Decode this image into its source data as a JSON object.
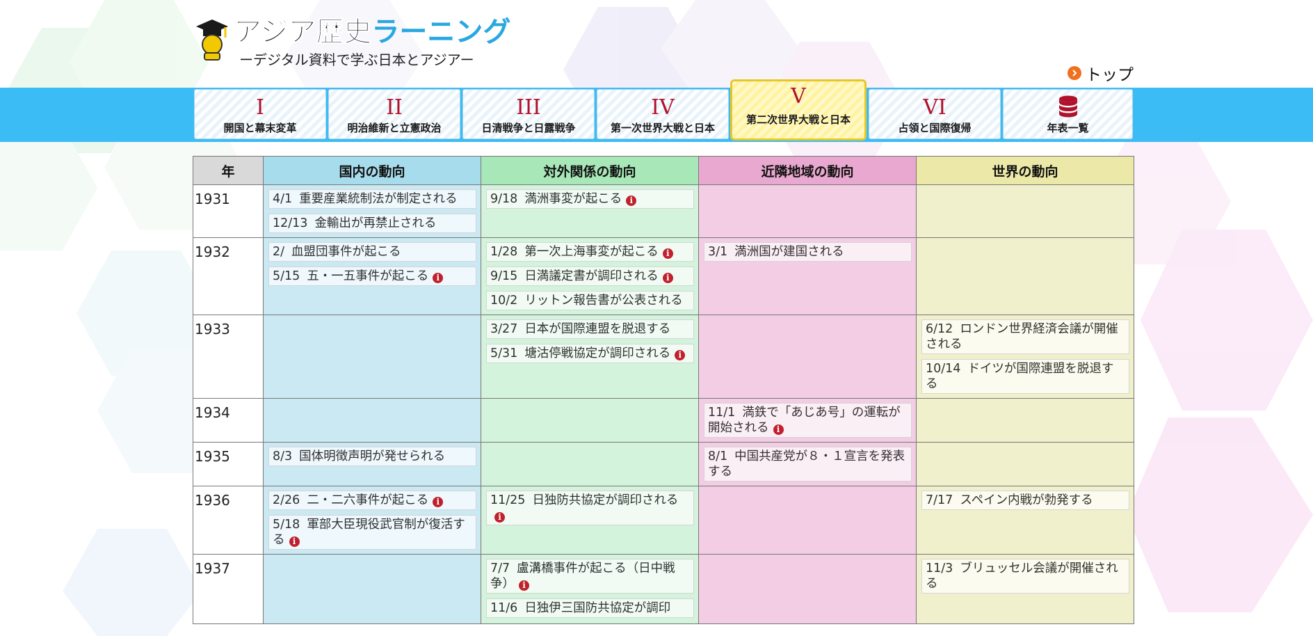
{
  "logo": {
    "title_a": "アジア歴史",
    "title_b": "ラーニング",
    "subtitle": "ーデジタル資料で学ぶ日本とアジアー"
  },
  "top_link": "トップ",
  "tabs": [
    {
      "num": "I",
      "label": "開国と幕末変革"
    },
    {
      "num": "II",
      "label": "明治維新と立憲政治"
    },
    {
      "num": "III",
      "label": "日清戦争と日露戦争"
    },
    {
      "num": "IV",
      "label": "第一次世界大戦と日本"
    },
    {
      "num": "V",
      "label": "第二次世界大戦と日本",
      "active": true
    },
    {
      "num": "VI",
      "label": "占領と国際復帰"
    },
    {
      "num": "",
      "label": "年表一覧"
    }
  ],
  "table": {
    "headers": {
      "year": "年",
      "domestic": "国内の動向",
      "foreign": "対外関係の動向",
      "neighbor": "近隣地域の動向",
      "world": "世界の動向"
    },
    "rows": [
      {
        "year": "1931",
        "domestic": [
          {
            "date": "4/1",
            "text": "重要産業統制法が制定される",
            "info": false
          },
          {
            "date": "12/13",
            "text": "金輸出が再禁止される",
            "info": false
          }
        ],
        "foreign": [
          {
            "date": "9/18",
            "text": "満洲事変が起こる",
            "info": true
          }
        ],
        "neighbor": [],
        "world": []
      },
      {
        "year": "1932",
        "domestic": [
          {
            "date": "2/",
            "text": "血盟団事件が起こる",
            "info": false
          },
          {
            "date": "5/15",
            "text": "五・一五事件が起こる",
            "info": true
          }
        ],
        "foreign": [
          {
            "date": "1/28",
            "text": "第一次上海事変が起こる",
            "info": true
          },
          {
            "date": "9/15",
            "text": "日満議定書が調印される",
            "info": true
          },
          {
            "date": "10/2",
            "text": "リットン報告書が公表される",
            "info": false
          }
        ],
        "neighbor": [
          {
            "date": "3/1",
            "text": "満洲国が建国される",
            "info": false
          }
        ],
        "world": []
      },
      {
        "year": "1933",
        "domestic": [],
        "foreign": [
          {
            "date": "3/27",
            "text": "日本が国際連盟を脱退する",
            "info": false
          },
          {
            "date": "5/31",
            "text": "塘沽停戦協定が調印される",
            "info": true
          }
        ],
        "neighbor": [],
        "world": [
          {
            "date": "6/12",
            "text": "ロンドン世界経済会議が開催される",
            "info": false
          },
          {
            "date": "10/14",
            "text": "ドイツが国際連盟を脱退する",
            "info": false
          }
        ]
      },
      {
        "year": "1934",
        "domestic": [],
        "foreign": [],
        "neighbor": [
          {
            "date": "11/1",
            "text": "満鉄で「あじあ号」の運転が開始される",
            "info": true
          }
        ],
        "world": []
      },
      {
        "year": "1935",
        "domestic": [
          {
            "date": "8/3",
            "text": "国体明徴声明が発せられる",
            "info": false
          }
        ],
        "foreign": [],
        "neighbor": [
          {
            "date": "8/1",
            "text": "中国共産党が８・１宣言を発表する",
            "info": false
          }
        ],
        "world": []
      },
      {
        "year": "1936",
        "domestic": [
          {
            "date": "2/26",
            "text": "二・二六事件が起こる",
            "info": true
          },
          {
            "date": "5/18",
            "text": "軍部大臣現役武官制が復活する",
            "info": true
          }
        ],
        "foreign": [
          {
            "date": "11/25",
            "text": "日独防共協定が調印される",
            "info": true
          }
        ],
        "neighbor": [],
        "world": [
          {
            "date": "7/17",
            "text": "スペイン内戦が勃発する",
            "info": false
          }
        ]
      },
      {
        "year": "1937",
        "domestic": [],
        "foreign": [
          {
            "date": "7/7",
            "text": "盧溝橋事件が起こる（日中戦争）",
            "info": true
          },
          {
            "date": "11/6",
            "text": "日独伊三国防共協定が調印",
            "info": false
          }
        ],
        "neighbor": [],
        "world": [
          {
            "date": "11/3",
            "text": "ブリュッセル会議が開催される",
            "info": false
          }
        ]
      }
    ]
  },
  "colors": {
    "navbar": "#3cbcf4",
    "active_tab": "#fff2a0",
    "numeral": "#b0122b",
    "info_icon": "#c0101e",
    "domestic_bg": "#cbe9f3",
    "foreign_bg": "#d3f3dc",
    "neighbor_bg": "#f2cde3",
    "world_bg": "#f1f0cc"
  },
  "icons": {
    "logo": "graduation-cap-icon",
    "top": "arrow-right-circle-icon",
    "timeline": "database-icon",
    "info": "info-icon"
  }
}
